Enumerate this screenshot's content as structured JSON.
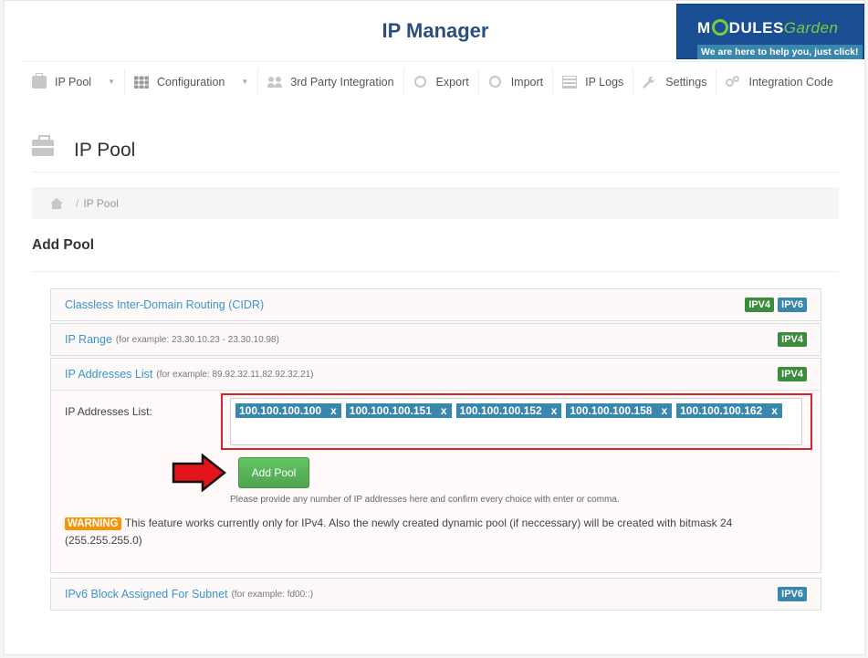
{
  "app": {
    "title": "IP Manager"
  },
  "logo": {
    "brand_main": "M",
    "brand_rest": "DULES",
    "brand_garden": "Garden",
    "tagline": "We are here to help you, just click!"
  },
  "nav": [
    {
      "label": "IP Pool",
      "icon": "briefcase-icon",
      "dropdown": true
    },
    {
      "label": "Configuration",
      "icon": "grid-icon",
      "dropdown": true
    },
    {
      "label": "3rd Party Integration",
      "icon": "users-icon",
      "dropdown": false
    },
    {
      "label": "Export",
      "icon": "export-icon",
      "dropdown": false
    },
    {
      "label": "Import",
      "icon": "import-icon",
      "dropdown": false
    },
    {
      "label": "IP Logs",
      "icon": "list-icon",
      "dropdown": false
    },
    {
      "label": "Settings",
      "icon": "wrench-icon",
      "dropdown": false
    },
    {
      "label": "Integration Code",
      "icon": "gears-icon",
      "dropdown": false
    }
  ],
  "page": {
    "title": "IP Pool",
    "breadcrumb_sep": "/",
    "breadcrumb_current": "IP Pool",
    "section_title": "Add Pool"
  },
  "panels": {
    "cidr": {
      "title": "Classless Inter-Domain Routing (CIDR)",
      "badges": [
        "IPV4",
        "IPV6"
      ]
    },
    "range": {
      "title": "IP Range",
      "hint": "(for example: 23.30.10.23 - 23.30.10.98)",
      "badges": [
        "IPV4"
      ]
    },
    "list": {
      "title": "IP Addresses List",
      "hint": "(for example: 89.92.32.11,82.92.32.21)",
      "badges": [
        "IPV4"
      ],
      "field_label": "IP Addresses List:",
      "tags": [
        "100.100.100.100",
        "100.100.100.151",
        "100.100.100.152",
        "100.100.100.158",
        "100.100.100.162"
      ],
      "tag_remove": "x",
      "add_button": "Add Pool",
      "help_text": "Please provide any number of IP addresses here and confirm every choice with enter or comma.",
      "warning_label": "WARNING",
      "warning_text": "This feature works currently only for IPv4. Also the newly created dynamic pool (if neccessary) will be created with bitmask 24 (255.255.255.0)"
    },
    "ipv6": {
      "title": "IPv6 Block Assigned For Subnet",
      "hint": "(for example: fd00::)",
      "badges": [
        "IPV6"
      ]
    }
  },
  "colors": {
    "title": "#2b4f7c",
    "link": "#3a95c9",
    "ipv4_badge": "#3d8b3d",
    "ipv6_badge": "#3a87ad",
    "tag": "#3a87ad",
    "highlight": "#d9222a",
    "button": "#5bb75b",
    "warning": "#f89406"
  }
}
